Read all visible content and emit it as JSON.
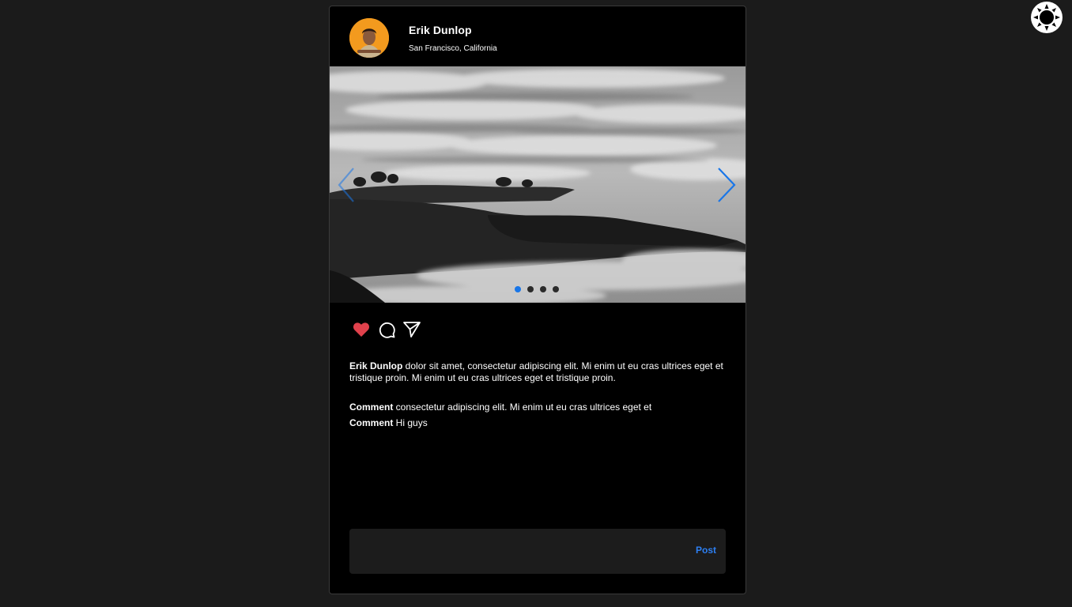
{
  "post": {
    "author": "Erik Dunlop",
    "location": "San Francisco, California",
    "caption_author": "Erik Dunlop",
    "caption_text": " dolor sit amet, consectetur adipiscing elit. Mi enim ut eu cras ultrices eget et tristique proin. Mi enim ut eu cras ultrices eget et tristique proin.",
    "liked": true,
    "carousel": {
      "total": 4,
      "active": 1
    }
  },
  "comments": [
    {
      "author": "Comment",
      "text": " consectetur adipiscing elit. Mi enim ut eu cras ultrices eget et"
    },
    {
      "author": "Comment",
      "text": " Hi guys"
    }
  ],
  "comment_form": {
    "placeholder": "",
    "post_label": "Post"
  },
  "colors": {
    "accent": "#1976e8",
    "like": "#e0414c",
    "post_link": "#2d7ff2",
    "background": "#1b1b1b",
    "card": "#000000"
  },
  "icons": {
    "theme": "sun-icon",
    "like": "heart-icon",
    "comment": "comment-bubble-icon",
    "share": "send-icon",
    "prev": "chevron-left-icon",
    "next": "chevron-right-icon"
  }
}
